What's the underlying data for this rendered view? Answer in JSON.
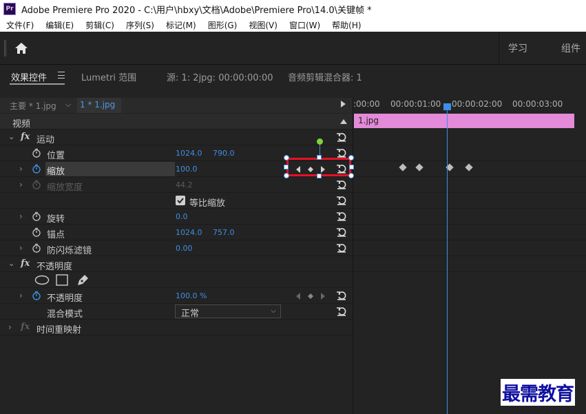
{
  "window": {
    "title": "Adobe Premiere Pro 2020 - C:\\用户\\hbxy\\文档\\Adobe\\Premiere Pro\\14.0\\关键帧 *",
    "app_icon": "Pr"
  },
  "menu": [
    "文件(F)",
    "编辑(E)",
    "剪辑(C)",
    "序列(S)",
    "标记(M)",
    "图形(G)",
    "视图(V)",
    "窗口(W)",
    "帮助(H)"
  ],
  "workspace": {
    "learn": "学习",
    "assembly": "组件"
  },
  "tabs": {
    "effect_controls": "效果控件",
    "lumetri": "Lumetri 范围",
    "source": "源: 1: 2jpg: 00:00:00:00",
    "audio_mixer": "音频剪辑混合器: 1"
  },
  "source_row": {
    "master": "主要 * 1.jpg",
    "clip": "1 * 1.jpg"
  },
  "effects": {
    "video_header": "视频",
    "motion": "运动",
    "position": {
      "label": "位置",
      "x": "1024.0",
      "y": "790.0"
    },
    "scale": {
      "label": "缩放",
      "value": "100.0"
    },
    "scale_width": {
      "label": "缩放宽度",
      "value": "44.2"
    },
    "uniform_scale": {
      "label": "等比缩放",
      "checked": true
    },
    "rotation": {
      "label": "旋转",
      "value": "0.0"
    },
    "anchor": {
      "label": "锚点",
      "x": "1024.0",
      "y": "757.0"
    },
    "anti_flicker": {
      "label": "防闪烁滤镜",
      "value": "0.00"
    },
    "opacity_section": "不透明度",
    "opacity": {
      "label": "不透明度",
      "value": "100.0 %"
    },
    "blend_mode": {
      "label": "混合模式",
      "value": "正常"
    },
    "time_remap": "时间重映射"
  },
  "timeline": {
    "ticks": [
      ":00:00",
      "00:00:01:00",
      "00:00:02:00",
      "00:00:03:00"
    ],
    "clip_name": "1.jpg"
  },
  "colors": {
    "clip": "#e38ad8",
    "playhead": "#3b8fe8",
    "highlight": "#e81123",
    "value": "#3f8fe0"
  },
  "watermark": "最需教育"
}
